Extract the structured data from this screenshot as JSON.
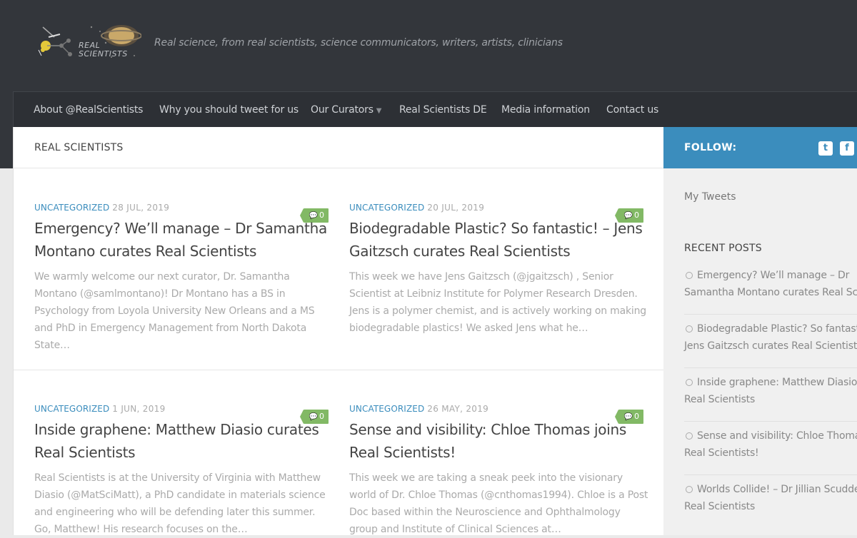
{
  "header": {
    "logo_label": "Real Scientists",
    "tagline": "Real science, from real scientists, science communicators, writers, artists, clinicians"
  },
  "nav": {
    "items": [
      {
        "label": "About @RealScientists"
      },
      {
        "label": "Why you should tweet for us"
      },
      {
        "label": "Our Curators"
      },
      {
        "label": "Real Scientists DE"
      },
      {
        "label": "Media information"
      },
      {
        "label": "Contact us"
      }
    ]
  },
  "main": {
    "page_title": "REAL SCIENTISTS",
    "posts": [
      {
        "category": "UNCATEGORIZED",
        "date": "28 JUL, 2019",
        "comments": "0",
        "title": "Emergency? We’ll manage – Dr Samantha Montano curates Real Scientists",
        "excerpt": "We warmly welcome our next curator, Dr. Samantha Montano (@samlmontano)! Dr Montano has a BS in Psychology from Loyola University New Orleans and a MS and PhD in Emergency Management from North Dakota State…"
      },
      {
        "category": "UNCATEGORIZED",
        "date": "20 JUL, 2019",
        "comments": "0",
        "title": "Biodegradable Plastic? So fantastic! – Jens Gaitzsch curates Real Scientists",
        "excerpt": "This week we have Jens Gaitzsch (@jgaitzsch) , Senior Scientist at Leibniz Institute for Polymer Research Dresden. Jens is a polymer chemist, and is actively working on making biodegradable plastics! We asked Jens what he…"
      },
      {
        "category": "UNCATEGORIZED",
        "date": "1 JUN, 2019",
        "comments": "0",
        "title": "Inside graphene: Matthew Diasio curates Real Scientists",
        "excerpt": "Real Scientists is at the University of Virginia with Matthew Diasio (@MatSciMatt), a PhD candidate in materials science and engineering who will be defending later this summer. Go, Matthew! His research focuses on the…"
      },
      {
        "category": "UNCATEGORIZED",
        "date": "26 MAY, 2019",
        "comments": "0",
        "title": "Sense and visibility: Chloe Thomas joins Real Scientists!",
        "excerpt": "This week we are taking a sneak peek into the visionary world of Dr. Chloe Thomas (@cnthomas1994). Chloe is a Post Doc based within the Neuroscience and Ophthalmology group and Institute of Clinical Sciences at…"
      }
    ]
  },
  "sidebar": {
    "follow_label": "FOLLOW:",
    "social_icons": [
      "twitter-icon",
      "facebook-icon"
    ],
    "my_tweets": "My Tweets",
    "recent_heading": "RECENT POSTS",
    "recent_posts": [
      {
        "line1": "Emergency? We’ll manage – Dr",
        "line2": "Samantha Montano curates Real Scientists"
      },
      {
        "line1": "Biodegradable Plastic? So fantastic! –",
        "line2": "Jens Gaitzsch curates Real Scientists"
      },
      {
        "line1": "Inside graphene: Matthew Diasio curates",
        "line2": "Real Scientists"
      },
      {
        "line1": "Sense and visibility: Chloe Thomas joins",
        "line2": "Real Scientists!"
      },
      {
        "line1": "Worlds Collide! – Dr Jillian Scudder joins",
        "line2": "Real Scientists"
      }
    ]
  },
  "colors": {
    "header_bg": "#33363b",
    "accent_blue": "#3b8dbd",
    "comment_green": "#82b965"
  }
}
